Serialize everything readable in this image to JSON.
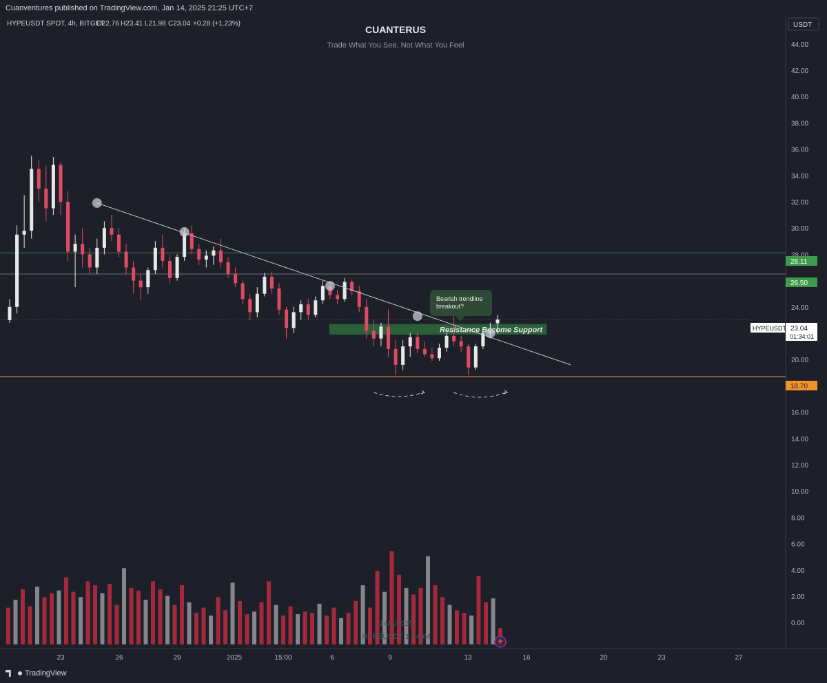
{
  "header": {
    "published": "Cuanventures published on TradingView.com, Jan 14, 2025 21:25 UTC+7",
    "symbol_info": "HYPEUSDT SPOT, 4h, BITGET",
    "ohlc": {
      "open": "O22.76",
      "high": "H23.41",
      "low": "L21.98",
      "close": "C23.04",
      "change": "+0.28 (+1.23%)"
    }
  },
  "watermark": {
    "title": "CUANTERUS",
    "subtitle": "Trade What You See, Not What You Feel"
  },
  "price_scale": {
    "currency": "USDT",
    "ticks": [
      "44.00",
      "42.00",
      "40.00",
      "38.00",
      "36.00",
      "34.00",
      "32.00",
      "30.00",
      "28.00",
      "26.00",
      "24.00",
      "22.00",
      "20.00",
      "18.00",
      "16.00",
      "14.00",
      "12.00",
      "10.00",
      "8.00",
      "6.00",
      "4.00",
      "2.00",
      "0.00"
    ],
    "level_labels": {
      "upper": "28.11",
      "mid": "26.50",
      "support": "18.70"
    },
    "current": {
      "symbol": "HYPEUSDT",
      "price": "23.04",
      "countdown": "01:34:01"
    }
  },
  "time_axis": {
    "labels": [
      "23",
      "26",
      "29",
      "2025",
      "15:00",
      "6",
      "9",
      "13",
      "16",
      "20",
      "23",
      "27"
    ]
  },
  "annotations": {
    "callout_line1": "Bearish trendline",
    "callout_line2": "breakout?",
    "zone_label": "Resistance Become Support"
  },
  "volume_watermark": {
    "date": "14/1/2025",
    "label": "HYPEUSDT 1.240M"
  },
  "footer": {
    "brand": "TradingView"
  },
  "colors": {
    "background": "#1e2029",
    "up": "#e8e8e8",
    "down": "#e04a63",
    "volume_up": "#8f9196",
    "volume_down": "#b22a3e",
    "zone": "#2e6b3c",
    "green_label": "#3f9b4c",
    "orange_label": "#f2922a",
    "trendline": "#c0c3c8"
  },
  "chart_data": {
    "type": "candlestick",
    "interval": "4h",
    "y_range": [
      17.5,
      45.0
    ],
    "horizontal_levels": [
      28.11,
      26.5,
      18.7
    ],
    "candles": [
      {
        "o": 23.0,
        "h": 24.6,
        "l": 22.8,
        "c": 24.0
      },
      {
        "o": 24.0,
        "h": 30.2,
        "l": 23.5,
        "c": 29.5
      },
      {
        "o": 29.5,
        "h": 32.5,
        "l": 28.5,
        "c": 29.8
      },
      {
        "o": 29.8,
        "h": 35.5,
        "l": 29.2,
        "c": 34.5
      },
      {
        "o": 34.5,
        "h": 35.2,
        "l": 32.0,
        "c": 33.0
      },
      {
        "o": 33.0,
        "h": 34.8,
        "l": 30.5,
        "c": 31.5
      },
      {
        "o": 31.5,
        "h": 35.4,
        "l": 31.0,
        "c": 34.8
      },
      {
        "o": 34.8,
        "h": 35.0,
        "l": 31.0,
        "c": 32.0
      },
      {
        "o": 32.0,
        "h": 32.8,
        "l": 27.5,
        "c": 28.2
      },
      {
        "o": 28.2,
        "h": 29.5,
        "l": 25.5,
        "c": 28.8
      },
      {
        "o": 28.8,
        "h": 30.0,
        "l": 27.0,
        "c": 28.0
      },
      {
        "o": 28.0,
        "h": 28.5,
        "l": 26.5,
        "c": 27.0
      },
      {
        "o": 27.0,
        "h": 29.2,
        "l": 26.5,
        "c": 28.5
      },
      {
        "o": 28.5,
        "h": 30.5,
        "l": 28.0,
        "c": 30.0
      },
      {
        "o": 30.0,
        "h": 31.0,
        "l": 29.0,
        "c": 29.5
      },
      {
        "o": 29.5,
        "h": 30.0,
        "l": 27.8,
        "c": 28.2
      },
      {
        "o": 28.2,
        "h": 28.8,
        "l": 26.5,
        "c": 27.0
      },
      {
        "o": 27.0,
        "h": 27.5,
        "l": 25.0,
        "c": 26.0
      },
      {
        "o": 26.0,
        "h": 26.5,
        "l": 24.5,
        "c": 25.5
      },
      {
        "o": 25.5,
        "h": 27.0,
        "l": 25.0,
        "c": 26.8
      },
      {
        "o": 26.8,
        "h": 29.0,
        "l": 26.5,
        "c": 28.5
      },
      {
        "o": 28.5,
        "h": 29.5,
        "l": 27.0,
        "c": 27.5
      },
      {
        "o": 27.5,
        "h": 28.0,
        "l": 25.8,
        "c": 26.2
      },
      {
        "o": 26.2,
        "h": 28.0,
        "l": 26.0,
        "c": 27.8
      },
      {
        "o": 27.8,
        "h": 30.0,
        "l": 27.5,
        "c": 29.6
      },
      {
        "o": 29.6,
        "h": 30.2,
        "l": 28.0,
        "c": 28.4
      },
      {
        "o": 28.4,
        "h": 28.8,
        "l": 27.2,
        "c": 27.6
      },
      {
        "o": 27.6,
        "h": 28.3,
        "l": 27.0,
        "c": 27.9
      },
      {
        "o": 27.9,
        "h": 28.6,
        "l": 27.2,
        "c": 28.3
      },
      {
        "o": 28.3,
        "h": 29.2,
        "l": 27.0,
        "c": 27.4
      },
      {
        "o": 27.4,
        "h": 27.8,
        "l": 26.2,
        "c": 26.5
      },
      {
        "o": 26.5,
        "h": 27.0,
        "l": 25.5,
        "c": 25.8
      },
      {
        "o": 25.8,
        "h": 26.0,
        "l": 24.2,
        "c": 24.6
      },
      {
        "o": 24.6,
        "h": 25.0,
        "l": 23.0,
        "c": 23.6
      },
      {
        "o": 23.6,
        "h": 25.5,
        "l": 23.2,
        "c": 25.0
      },
      {
        "o": 25.0,
        "h": 26.6,
        "l": 24.8,
        "c": 26.3
      },
      {
        "o": 26.3,
        "h": 26.7,
        "l": 25.0,
        "c": 25.4
      },
      {
        "o": 25.4,
        "h": 25.8,
        "l": 23.4,
        "c": 23.8
      },
      {
        "o": 23.8,
        "h": 24.0,
        "l": 21.6,
        "c": 22.4
      },
      {
        "o": 22.4,
        "h": 24.0,
        "l": 22.0,
        "c": 23.6
      },
      {
        "o": 23.6,
        "h": 24.5,
        "l": 23.0,
        "c": 24.2
      },
      {
        "o": 24.2,
        "h": 24.6,
        "l": 23.0,
        "c": 23.4
      },
      {
        "o": 23.4,
        "h": 24.8,
        "l": 23.2,
        "c": 24.5
      },
      {
        "o": 24.5,
        "h": 26.0,
        "l": 24.2,
        "c": 25.6
      },
      {
        "o": 25.6,
        "h": 25.9,
        "l": 24.6,
        "c": 24.9
      },
      {
        "o": 24.9,
        "h": 25.3,
        "l": 24.2,
        "c": 24.6
      },
      {
        "o": 24.6,
        "h": 26.2,
        "l": 24.4,
        "c": 25.9
      },
      {
        "o": 25.9,
        "h": 26.1,
        "l": 24.9,
        "c": 25.2
      },
      {
        "o": 25.2,
        "h": 25.6,
        "l": 23.6,
        "c": 24.0
      },
      {
        "o": 24.0,
        "h": 24.6,
        "l": 21.6,
        "c": 22.2
      },
      {
        "o": 22.2,
        "h": 23.0,
        "l": 21.0,
        "c": 21.6
      },
      {
        "o": 21.6,
        "h": 22.8,
        "l": 21.0,
        "c": 22.5
      },
      {
        "o": 22.5,
        "h": 23.8,
        "l": 20.2,
        "c": 20.8
      },
      {
        "o": 20.8,
        "h": 21.5,
        "l": 18.8,
        "c": 19.6
      },
      {
        "o": 19.6,
        "h": 21.5,
        "l": 19.2,
        "c": 21.0
      },
      {
        "o": 21.0,
        "h": 22.0,
        "l": 20.2,
        "c": 21.7
      },
      {
        "o": 21.7,
        "h": 22.0,
        "l": 20.5,
        "c": 20.8
      },
      {
        "o": 20.8,
        "h": 21.4,
        "l": 20.2,
        "c": 20.4
      },
      {
        "o": 20.4,
        "h": 20.9,
        "l": 19.9,
        "c": 20.1
      },
      {
        "o": 20.1,
        "h": 21.2,
        "l": 19.9,
        "c": 20.9
      },
      {
        "o": 20.9,
        "h": 22.0,
        "l": 20.6,
        "c": 21.8
      },
      {
        "o": 21.8,
        "h": 23.4,
        "l": 21.0,
        "c": 21.4
      },
      {
        "o": 21.4,
        "h": 21.8,
        "l": 20.6,
        "c": 21.0
      },
      {
        "o": 21.0,
        "h": 21.2,
        "l": 18.8,
        "c": 19.4
      },
      {
        "o": 19.4,
        "h": 21.2,
        "l": 19.2,
        "c": 21.0
      },
      {
        "o": 21.0,
        "h": 22.4,
        "l": 20.8,
        "c": 22.0
      },
      {
        "o": 22.0,
        "h": 22.8,
        "l": 21.6,
        "c": 22.1
      },
      {
        "o": 22.76,
        "h": 23.41,
        "l": 21.98,
        "c": 23.04
      }
    ],
    "volume_values_m": [
      2.8,
      3.4,
      4.2,
      2.9,
      4.4,
      3.6,
      3.9,
      4.1,
      5.1,
      4.0,
      3.6,
      4.8,
      4.5,
      3.9,
      4.6,
      3.0,
      5.8,
      4.3,
      4.1,
      3.4,
      4.8,
      4.2,
      3.7,
      3.0,
      4.5,
      3.2,
      2.4,
      2.8,
      2.2,
      3.6,
      2.6,
      4.7,
      3.3,
      2.3,
      2.5,
      3.2,
      4.8,
      3.0,
      2.2,
      2.9,
      2.3,
      2.5,
      2.4,
      3.1,
      2.2,
      2.8,
      2.0,
      2.4,
      3.3,
      4.5,
      2.8,
      5.6,
      4.0,
      7.1,
      5.3,
      4.3,
      3.8,
      4.3,
      6.7,
      4.5,
      3.6,
      3.0,
      2.6,
      2.4,
      2.2,
      5.2,
      3.2,
      3.5,
      1.24
    ],
    "volume_colors": "alternating by candle direction",
    "trendline": {
      "from": {
        "index": 12,
        "price": 31.9
      },
      "to": {
        "index": 86,
        "price": 19.6
      }
    },
    "touch_points": [
      {
        "index": 12,
        "price": 31.9
      },
      {
        "index": 24,
        "price": 29.7
      },
      {
        "index": 44,
        "price": 25.6
      },
      {
        "index": 56,
        "price": 23.3
      },
      {
        "index": 66,
        "price": 22.0
      }
    ],
    "support_zone": {
      "from_index": 56,
      "to_index": 94,
      "low": 21.9,
      "high": 22.7
    }
  }
}
